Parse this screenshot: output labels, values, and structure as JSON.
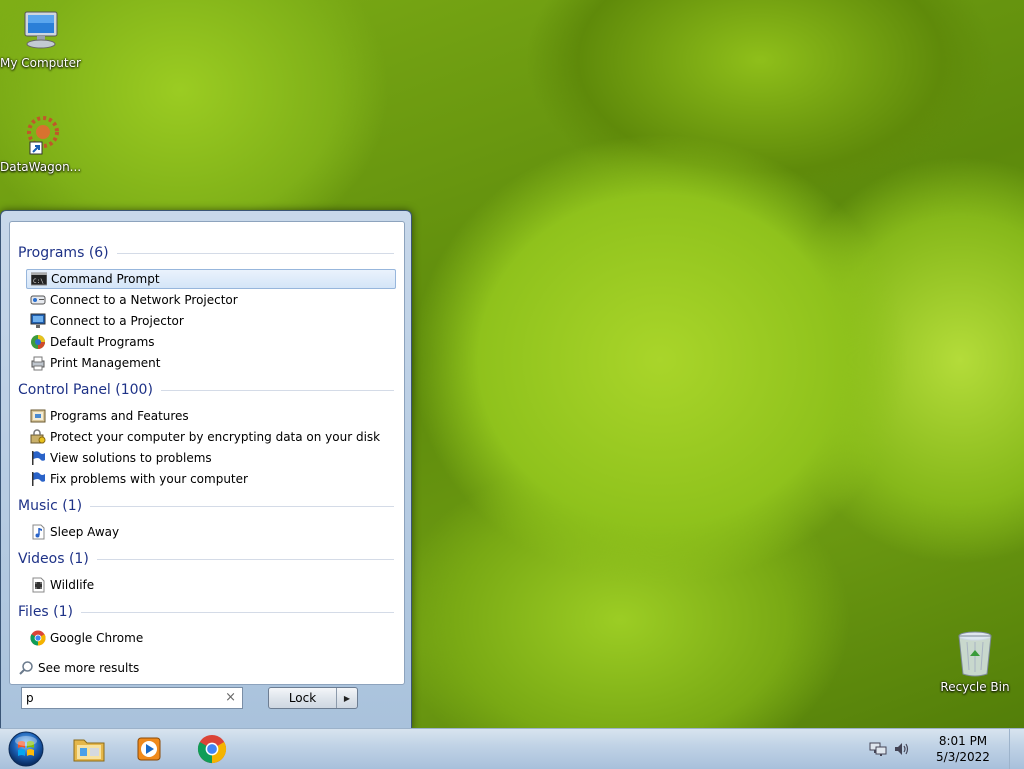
{
  "desktop": {
    "icons": [
      {
        "label": "My Computer",
        "icon": "computer-icon"
      },
      {
        "label": "DataWagon...",
        "icon": "datawagon-shortcut-icon"
      },
      {
        "label": "Recycle Bin",
        "icon": "recycle-bin-icon"
      }
    ]
  },
  "start_menu": {
    "groups": [
      {
        "title": "Programs (6)",
        "items": [
          {
            "label": "Command Prompt",
            "icon": "cmd-icon",
            "selected": true
          },
          {
            "label": "Connect to a Network Projector",
            "icon": "network-projector-icon"
          },
          {
            "label": "Connect to a Projector",
            "icon": "projector-icon"
          },
          {
            "label": "Default Programs",
            "icon": "default-programs-icon"
          },
          {
            "label": "Print Management",
            "icon": "print-management-icon"
          }
        ]
      },
      {
        "title": "Control Panel (100)",
        "items": [
          {
            "label": "Programs and Features",
            "icon": "programs-features-icon"
          },
          {
            "label": "Protect your computer by encrypting data on your disk",
            "icon": "bitlocker-icon"
          },
          {
            "label": "View solutions to problems",
            "icon": "action-center-flag-icon"
          },
          {
            "label": "Fix problems with your computer",
            "icon": "action-center-flag-icon"
          }
        ]
      },
      {
        "title": "Music (1)",
        "items": [
          {
            "label": "Sleep Away",
            "icon": "music-file-icon"
          }
        ]
      },
      {
        "title": "Videos (1)",
        "items": [
          {
            "label": "Wildlife",
            "icon": "video-file-icon"
          }
        ]
      },
      {
        "title": "Files (1)",
        "items": [
          {
            "label": "Google Chrome",
            "icon": "chrome-icon"
          }
        ]
      }
    ],
    "see_more": "See more results",
    "search_value": "p",
    "clear_glyph": "×",
    "lock_label": "Lock",
    "lock_arrow": "▶"
  },
  "taskbar": {
    "pinned": [
      {
        "name": "windows-explorer",
        "icon": "folder-icon"
      },
      {
        "name": "media-player",
        "icon": "media-player-icon"
      },
      {
        "name": "google-chrome",
        "icon": "chrome-icon"
      }
    ],
    "clock_time": "8:01 PM",
    "clock_date": "5/3/2022"
  },
  "colors": {
    "group_header": "#1e3287",
    "taskbar": "#c1d3e6",
    "selection": "#d4e5f8"
  }
}
